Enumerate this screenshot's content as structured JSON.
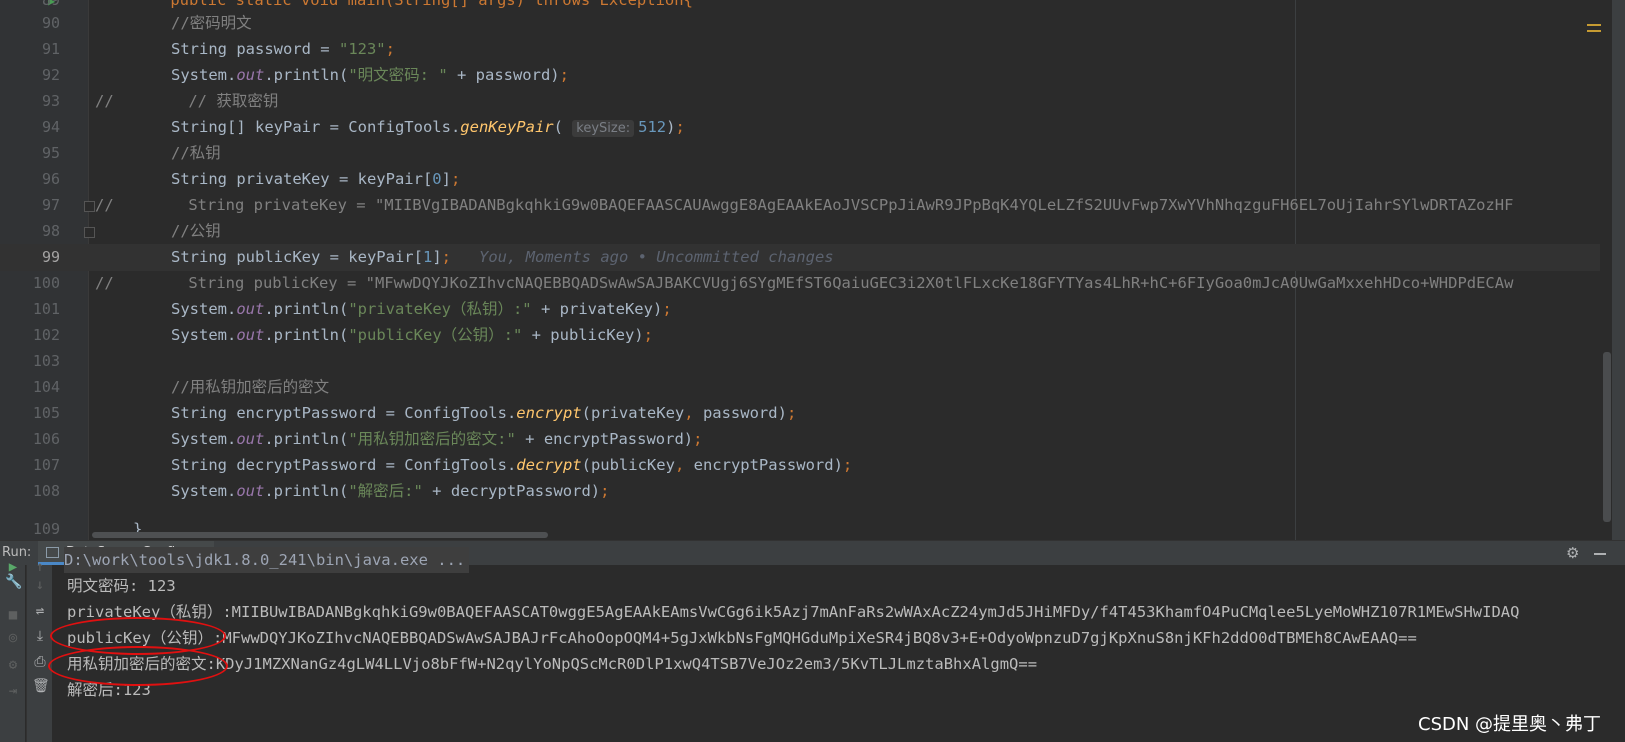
{
  "editor": {
    "top_partial": "    public static void main(String[] args) throws Exception{",
    "lines": [
      {
        "n": "90",
        "comment": "//密码明文"
      },
      {
        "n": "91"
      },
      {
        "n": "92"
      },
      {
        "n": "93",
        "comment": "//        // 获取密钥"
      },
      {
        "n": "94",
        "hint": "keySize:"
      },
      {
        "n": "95",
        "comment": "//私钥"
      },
      {
        "n": "96"
      },
      {
        "n": "97",
        "comment": "//        String privateKey = \"MIIBVgIBADANBgkqhkiG9w0BAQEFAASCAUAwggE8AgEAAkEAoJVSCPpJiAwR9JPpBqK4YQLeLZfS2UUvFwp7XwYVhNhqzguFH6EL7oUjIahrSYlwDRTAZozHF"
      },
      {
        "n": "98",
        "comment": "//公钥"
      },
      {
        "n": "99",
        "blame": "You, Moments ago • Uncommitted changes"
      },
      {
        "n": "100",
        "comment": "//        String publicKey = \"MFwwDQYJKoZIhvcNAQEBBQADSwAwSAJBAKCVUgj6SYgMEfST6QaiuGEC3i2X0tlFLxcKe18GFYTYas4LhR+hC+6FIyGoa0mJcA0UwGaMxxehHDco+WHDPdECAw"
      },
      {
        "n": "101"
      },
      {
        "n": "102"
      },
      {
        "n": "103"
      },
      {
        "n": "104",
        "comment": "//用私钥加密后的密文"
      },
      {
        "n": "105"
      },
      {
        "n": "106"
      },
      {
        "n": "107"
      },
      {
        "n": "108"
      },
      {
        "n": "109"
      }
    ],
    "strings": {
      "s91": "\"123\"",
      "s92": "\"明文密码: \"",
      "n94": "512",
      "n96": "0",
      "n99": "1",
      "s101": "\"privateKey（私钥）:\"",
      "s102": "\"publicKey（公钥）:\"",
      "s106": "\"用私钥加密后的密文:\"",
      "s108": "\"解密后:\""
    }
  },
  "run_panel": {
    "label": "Run:",
    "tab": "DataSourceConfig",
    "tab_close": "×"
  },
  "console": {
    "cmd": "D:\\work\\tools\\jdk1.8.0_241\\bin\\java.exe ...",
    "out1": "明文密码: 123",
    "out2": "privateKey（私钥）:MIIBUwIBADANBgkqhkiG9w0BAQEFAASCAT0wggE5AgEAAkEAmsVwCGg6ik5Azj7mAnFaRs2wWAxAcZ24ymJd5JHiMFDy/f4T453KhamfO4PuCMqlee5LyeMoWHZ107R1MEwSHwIDAQ",
    "out3": "publicKey（公钥）:MFwwDQYJKoZIhvcNAQEBBQADSwAwSAJBAJrFcAhoOopOQM4+5gJxWkbNsFgMQHGduMpiXeSR4jBQ8v3+E+OdyoWpnzuD7gjKpXnuS8njKFh2ddO0dTBMEh8CAwEAAQ==",
    "out4": "用私钥加密后的密文:KDyJ1MZXNanGz4gLW4LLVjo8bFfW+N2qylYoNpQScMcR0DlP1xwQ4TSB7VeJOz2em3/5KvTLJLmztaBhxAlgmQ==",
    "out5": "解密后:123"
  },
  "watermark": "CSDN @提里奥丶弗丁",
  "colors": {
    "annotation": "#e01010",
    "keyword": "#cc7832",
    "string": "#6a8759"
  }
}
